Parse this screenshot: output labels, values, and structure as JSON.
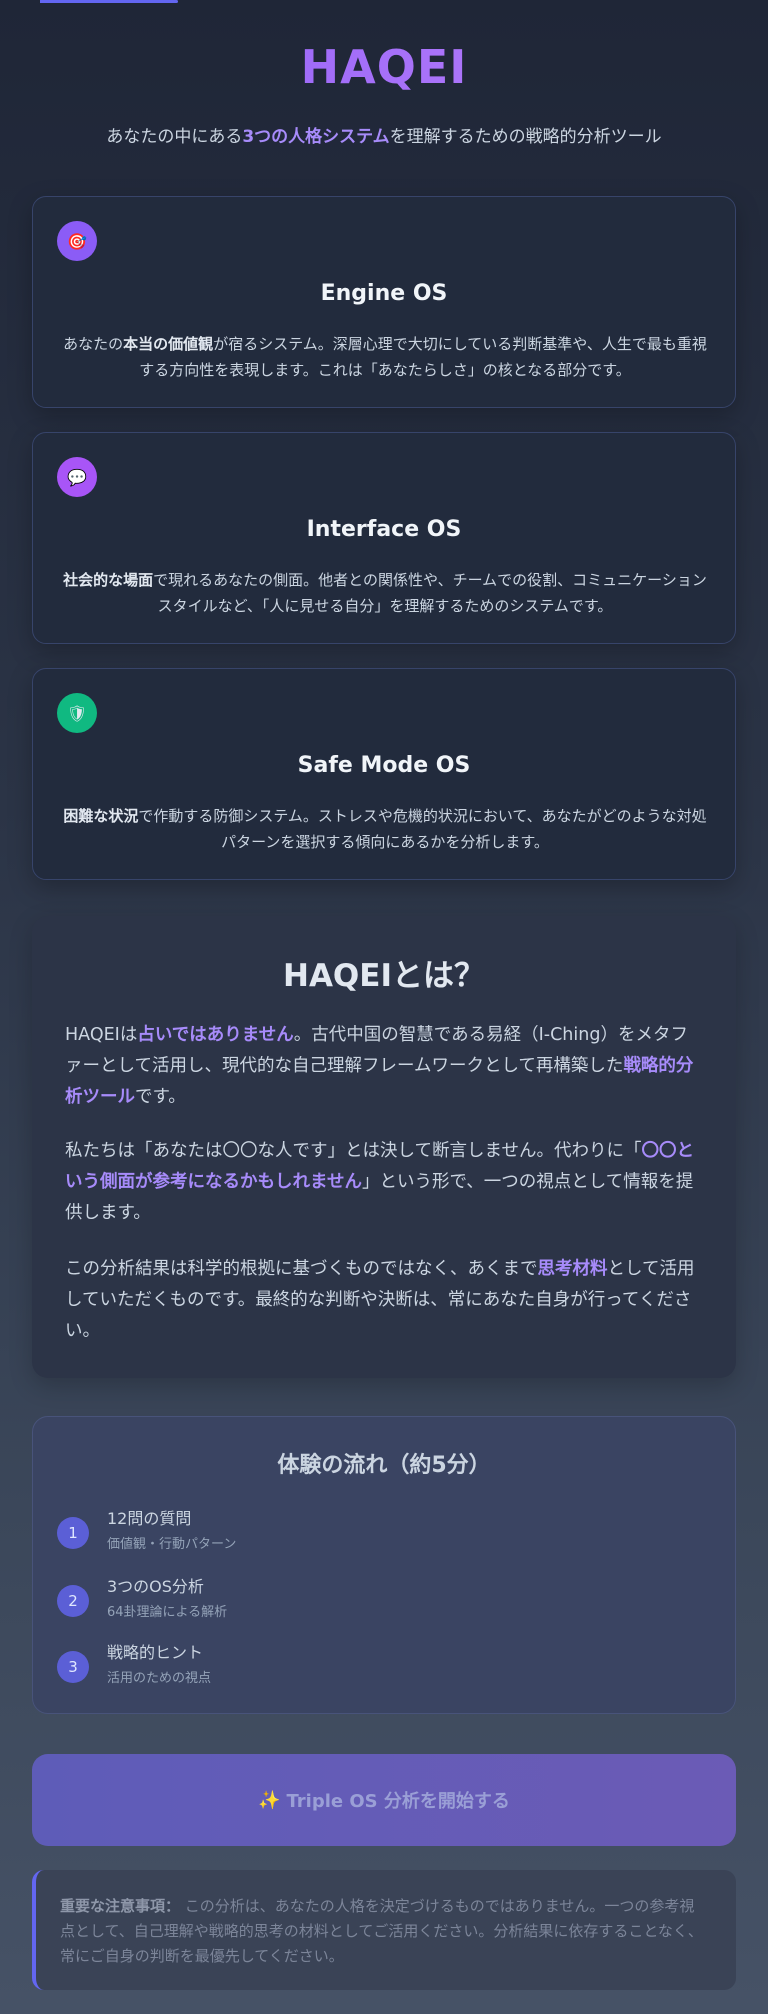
{
  "progress": 0.18,
  "header": {
    "logo": "HAQEI",
    "tagline_pre": "あなたの中にある",
    "tagline_hl": "3つの人格システム",
    "tagline_post": "を理解するための戦略的分析ツール"
  },
  "os_cards": [
    {
      "icon": "target-icon",
      "icon_glyph": "🎯",
      "icon_color": "#8b5cf6",
      "title": "Engine OS",
      "desc_pre": "あなたの",
      "desc_bold": "本当の価値観",
      "desc_post": "が宿るシステム。深層心理で大切にしている判断基準や、人生で最も重視する方向性を表現します。これは「あなたらしさ」の核となる部分です。"
    },
    {
      "icon": "speech-bubble-icon",
      "icon_glyph": "💬",
      "icon_color": "#a855f7",
      "title": "Interface OS",
      "desc_pre": "",
      "desc_bold": "社会的な場面",
      "desc_post": "で現れるあなたの側面。他者との関係性や、チームでの役割、コミュニケーションスタイルなど、「人に見せる自分」を理解するためのシステムです。"
    },
    {
      "icon": "shield-icon",
      "icon_glyph": "🛡",
      "icon_color": "#10b981",
      "title": "Safe Mode OS",
      "desc_pre": "",
      "desc_bold": "困難な状況",
      "desc_post": "で作動する防御システム。ストレスや危機的状況において、あなたがどのような対処パターンを選択する傾向にあるかを分析します。"
    }
  ],
  "about": {
    "title": "HAQEIとは？",
    "p1_a": "HAQEIは",
    "p1_hl1": "占いではありません",
    "p1_b": "。古代中国の智慧である易経（I-Ching）をメタファーとして活用し、現代的な自己理解フレームワークとして再構築した",
    "p1_hl2": "戦略的分析ツール",
    "p1_c": "です。",
    "p2_a": "私たちは「あなたは〇〇な人です」とは決して断言しません。代わりに「",
    "p2_hl": "〇〇という側面が参考になるかもしれません",
    "p2_b": "」という形で、一つの視点として情報を提供します。",
    "p3_a": "この分析結果は科学的根拠に基づくものではなく、あくまで",
    "p3_hl": "思考材料",
    "p3_b": "として活用していただくものです。最終的な判断や決断は、常にあなた自身が行ってください。"
  },
  "flow": {
    "title": "体験の流れ（約5分）",
    "steps": [
      {
        "num": "1",
        "title": "12問の質問",
        "sub": "価値観・行動パターン"
      },
      {
        "num": "2",
        "title": "3つのOS分析",
        "sub": "64卦理論による解析"
      },
      {
        "num": "3",
        "title": "戦略的ヒント",
        "sub": "活用のための視点"
      }
    ]
  },
  "cta": {
    "spark": "✨",
    "label": "Triple OS 分析を開始する"
  },
  "notice": {
    "bold": "重要な注意事項：",
    "text": " この分析は、あなたの人格を決定づけるものではありません。一つの参考視点として、自己理解や戦略的思考の材料としてご活用ください。分析結果に依存することなく、常にご自身の判断を最優先してください。"
  }
}
